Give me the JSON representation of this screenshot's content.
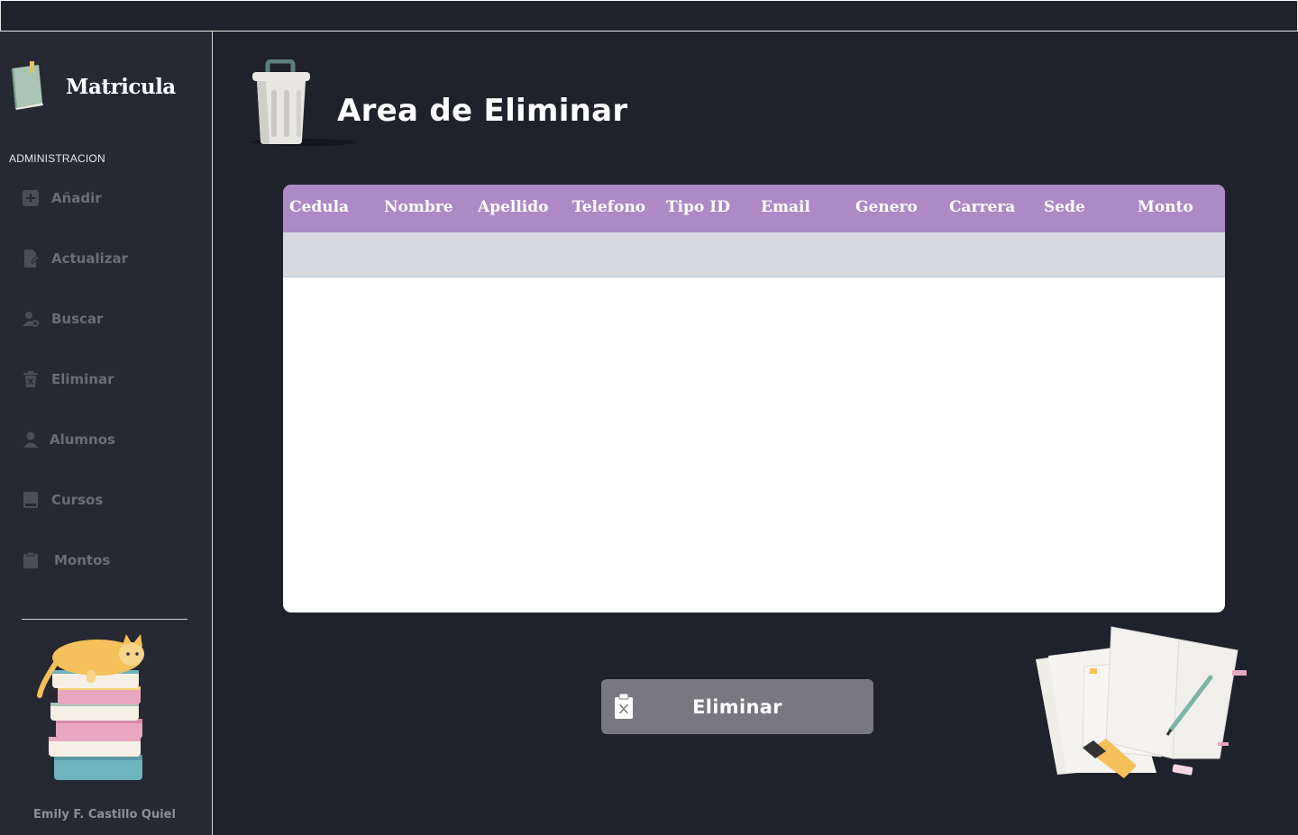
{
  "brand": {
    "title": "Matricula",
    "icon": "notebook-icon"
  },
  "sidebar": {
    "section_label": "ADMINISTRACION",
    "items": [
      {
        "label": "Añadir",
        "icon": "add-square-icon"
      },
      {
        "label": "Actualizar",
        "icon": "document-edit-icon"
      },
      {
        "label": "Buscar",
        "icon": "user-search-icon"
      },
      {
        "label": "Eliminar",
        "icon": "trash-icon"
      },
      {
        "label": "Alumnos",
        "icon": "person-icon"
      },
      {
        "label": "Cursos",
        "icon": "book-icon"
      },
      {
        "label": "Montos",
        "icon": "clipboard-icon"
      }
    ],
    "author": "Emily F. Castillo Quiel"
  },
  "main": {
    "title": "Area de Eliminar",
    "title_icon": "trash-can-icon"
  },
  "table": {
    "columns": [
      "Cedula",
      "Nombre",
      "Apellido",
      "Telefono",
      "Tipo ID",
      "Email",
      "Genero",
      "Carrera",
      "Sede",
      "Monto"
    ],
    "rows": [],
    "header_color": "#ad8ac6"
  },
  "actions": {
    "delete_label": "Eliminar",
    "delete_icon": "clipboard-x-icon"
  },
  "colors": {
    "background": "#1f212b",
    "sidebar": "#262832",
    "button": "#78787e"
  }
}
